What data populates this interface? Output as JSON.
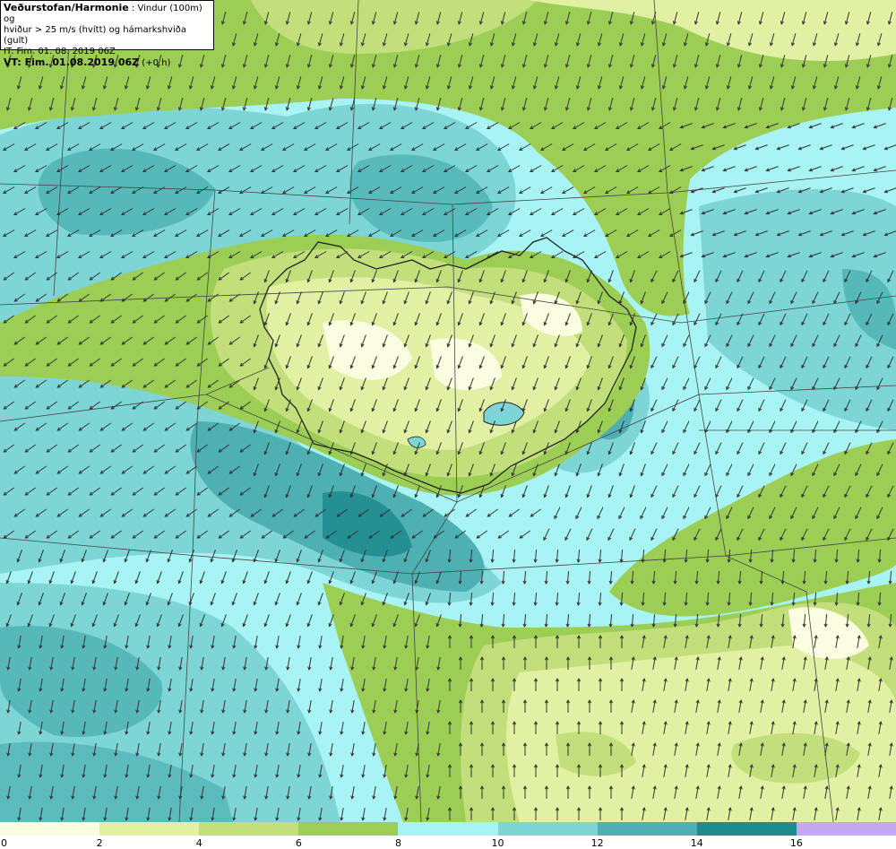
{
  "header": {
    "source": "Veðurstofan/Harmonie",
    "description_1": " : Vindur (100m) og",
    "description_2": "hviður > 25 m/s (hvítt) og hámarkshviða (gult)",
    "initial_time": "IT: Fim. 01. 08. 2019 06Z",
    "valid_time": "VT: Fim. 01.08.2019 06Z",
    "lead_time": " (+0 h)"
  },
  "legend": {
    "levels": [
      {
        "label": "0",
        "color": "#fbfde0"
      },
      {
        "label": "2",
        "color": "#e2f0a4"
      },
      {
        "label": "4",
        "color": "#c2df7c"
      },
      {
        "label": "6",
        "color": "#9ccd54"
      },
      {
        "label": "8",
        "color": "#a8f3f3"
      },
      {
        "label": "10",
        "color": "#7ed5d6"
      },
      {
        "label": "12",
        "color": "#4eb0b2"
      },
      {
        "label": "14",
        "color": "#1f8b8d"
      },
      {
        "label": "16",
        "color": "#c5a8f2"
      }
    ]
  },
  "colors": {
    "coast": "#222222",
    "grid": "#444444",
    "arrow": "#333333"
  }
}
